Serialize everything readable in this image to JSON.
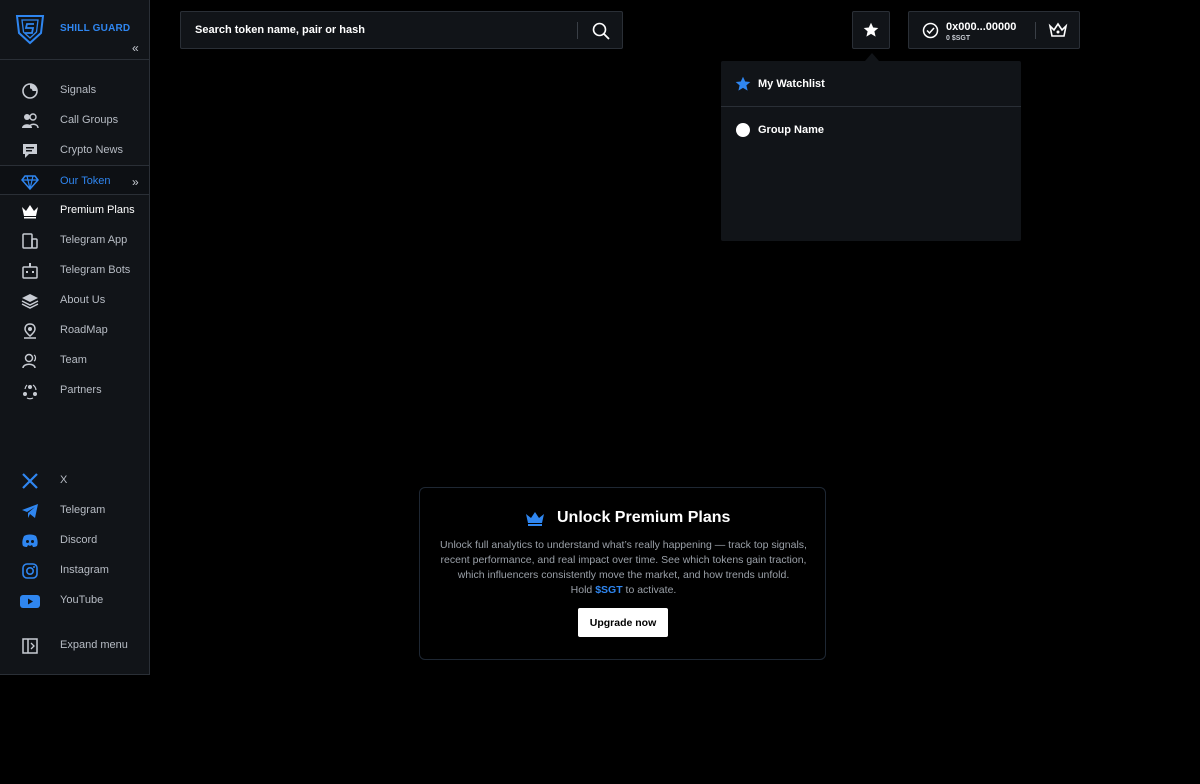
{
  "brand": {
    "name": "SHILL GUARD"
  },
  "nav": {
    "items": [
      {
        "label": "Signals",
        "icon": "pie-chart-icon"
      },
      {
        "label": "Call Groups",
        "icon": "users-icon"
      },
      {
        "label": "Crypto News",
        "icon": "message-icon"
      },
      {
        "label": "Our Token",
        "icon": "diamond-icon",
        "active": true
      },
      {
        "label": "Premium Plans",
        "icon": "crown-icon"
      },
      {
        "label": "Telegram App",
        "icon": "devices-icon"
      },
      {
        "label": "Telegram Bots",
        "icon": "bot-icon"
      },
      {
        "label": "About Us",
        "icon": "layers-icon"
      },
      {
        "label": "RoadMap",
        "icon": "map-pin-icon"
      },
      {
        "label": "Team",
        "icon": "team-icon"
      },
      {
        "label": "Partners",
        "icon": "partners-icon"
      }
    ]
  },
  "social": {
    "items": [
      {
        "label": "X",
        "icon": "x-icon"
      },
      {
        "label": "Telegram",
        "icon": "telegram-icon"
      },
      {
        "label": "Discord",
        "icon": "discord-icon"
      },
      {
        "label": "Instagram",
        "icon": "instagram-icon"
      },
      {
        "label": "YouTube",
        "icon": "youtube-icon"
      }
    ]
  },
  "expand_menu": {
    "label": "Expand menu"
  },
  "search": {
    "placeholder": "Search token name, pair or hash"
  },
  "wallet": {
    "address": "0x000...00000",
    "balance": "0 $SGT"
  },
  "watchlist": {
    "title": "My Watchlist",
    "groups": [
      {
        "name": "Group Name"
      }
    ]
  },
  "premium": {
    "title": "Unlock Premium Plans",
    "description": "Unlock full analytics to understand what’s really happening — track top signals, recent performance, and real impact over time. See which tokens gain traction, which influencers consistently move the market, and how trends unfold.",
    "hold_prefix": "Hold",
    "token": "$SGT",
    "hold_suffix": "to activate.",
    "cta": "Upgrade now"
  },
  "colors": {
    "accent": "#2f86f0",
    "panel": "#111418",
    "border": "#2a2f36",
    "background": "#000000"
  }
}
